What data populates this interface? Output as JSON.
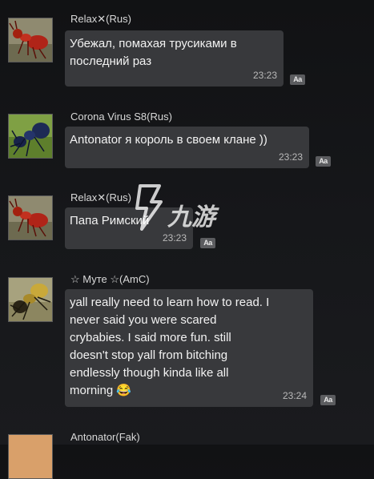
{
  "messages": [
    {
      "sender": "Relax✕(Rus)",
      "text": "Убежал, помахая трусиками в\nпоследний раз",
      "time": "23:23",
      "translate_label": "Aa"
    },
    {
      "sender": "Corona Virus S8(Rus)",
      "text": "Antonator я король в своем клане ))",
      "time": "23:23",
      "translate_label": "Aa"
    },
    {
      "sender": "Relax✕(Rus)",
      "text": "Папа Римский",
      "time": "23:23",
      "translate_label": "Aa"
    },
    {
      "sender": "☆ Муте ☆(AmC)",
      "text": "yall really need to learn how to read. I\nnever said you were scared\ncrybabies. I said more fun. still\ndoesn't stop yall from bitching\nendlessly though kinda like all\nmorning 😂",
      "time": "23:24",
      "translate_label": "Aa"
    },
    {
      "sender": "Antonator(Fak)"
    }
  ],
  "watermark": {
    "text": "九游"
  },
  "colors": {
    "bubble": "#38393c",
    "background": "#141517",
    "ant_red": "#b02418",
    "ant_blue": "#1d2a55",
    "ant_yellow": "#c9a93a"
  }
}
